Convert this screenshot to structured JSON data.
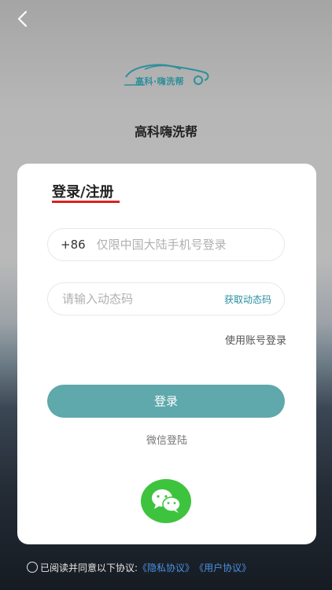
{
  "header": {
    "back_icon": "chevron-left-icon"
  },
  "brand": {
    "logo_text": "高科·嗨洗帮",
    "app_name": "高科嗨洗帮",
    "logo_color": "#2f8f9a"
  },
  "login_card": {
    "title": "登录/注册",
    "title_underline_color": "#d9221c",
    "phone": {
      "country_code": "+86",
      "placeholder": "仅限中国大陆手机号登录",
      "value": ""
    },
    "code": {
      "placeholder": "请输入动态码",
      "value": "",
      "get_code_label": "获取动态码"
    },
    "account_login_label": "使用账号登录",
    "login_button_label": "登录",
    "login_button_color": "#5fa8ac",
    "wechat_label": "微信登陆",
    "wechat_icon": "wechat-icon",
    "wechat_color": "#3ec33e"
  },
  "agreement": {
    "checked": false,
    "text": "已阅读并同意以下协议:",
    "privacy_label": "《隐私协议》",
    "user_label": "《用户协议》",
    "link_color": "#4a90e2"
  }
}
